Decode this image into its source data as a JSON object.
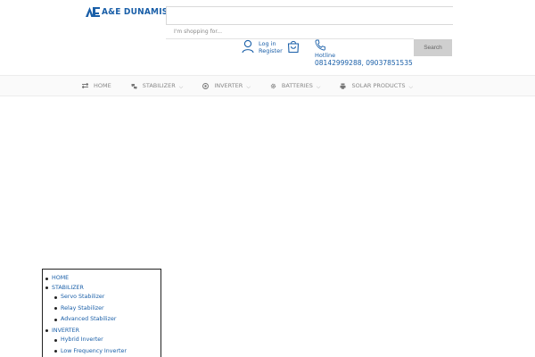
{
  "header": {
    "logo_text": "A&E DUNAMIS",
    "search": {
      "placeholder": "I'm shopping for...",
      "button_label": "Search"
    },
    "account": {
      "login_label": "Log in",
      "register_label": "Register"
    },
    "hotline": {
      "label": "Hotline",
      "numbers": "08142999288, 09037851535"
    }
  },
  "nav": {
    "items": [
      {
        "label": "HOME",
        "icon": "home-icon"
      },
      {
        "label": "STABILIZER",
        "icon": "stabilizer-icon"
      },
      {
        "label": "INVERTER",
        "icon": "inverter-icon"
      },
      {
        "label": "BATTERIES",
        "icon": "battery-icon"
      },
      {
        "label": "SOLAR PRODUCTS",
        "icon": "solar-icon"
      }
    ]
  },
  "sitemap": {
    "items": [
      {
        "label": "HOME",
        "level": 0
      },
      {
        "label": "STABILIZER",
        "level": 0
      },
      {
        "label": "Servo Stabilizer",
        "level": 1
      },
      {
        "label": "Relay Stabilizer",
        "level": 1
      },
      {
        "label": "Advanced Stabilizer",
        "level": 1
      },
      {
        "label": "INVERTER",
        "level": 0
      },
      {
        "label": "Hybrid Inverter",
        "level": 1
      },
      {
        "label": "Low Frequency Inverter",
        "level": 1
      }
    ]
  },
  "colors": {
    "brand": "#1a5fa8",
    "link": "#1a5fa8",
    "nav_text": "#888888",
    "button_bg": "#cfcfcf"
  }
}
